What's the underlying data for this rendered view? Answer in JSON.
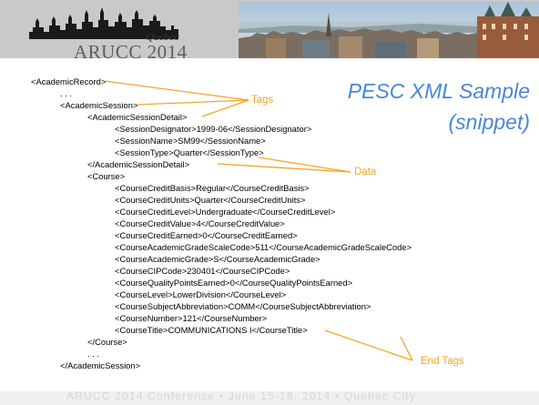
{
  "header": {
    "logo_org": "ARUCC 2014",
    "logo_place": "Quebec"
  },
  "title": {
    "line1": "PESC XML Sample",
    "line2": "(snippet)"
  },
  "code_lines": [
    "<AcademicRecord>",
    ". . .",
    "<AcademicSession>",
    "<AcademicSessionDetail>",
    "<SessionDesignator>1999-06</SessionDesignator>",
    "<SessionName>SM99</SessionName>",
    "<SessionType>Quarter</SessionType>",
    "</AcademicSessionDetail>",
    "<Course>",
    "<CourseCreditBasis>Regular</CourseCreditBasis>",
    "<CourseCreditUnits>Quarter</CourseCreditUnits>",
    "<CourseCreditLevel>Undergraduate</CourseCreditLevel>",
    "<CourseCreditValue>4</CourseCreditValue>",
    "<CourseCreditEarned>0</CourseCreditEarned>",
    "<CourseAcademicGradeScaleCode>511</CourseAcademicGradeScaleCode>",
    "<CourseAcademicGrade>S</CourseAcademicGrade>",
    "<CourseCIPCode>230401</CourseCIPCode>",
    "<CourseQualityPointsEarned>0</CourseQualityPointsEarned>",
    "<CourseLevel>LowerDivision</CourseLevel>",
    "<CourseSubjectAbbreviation>COMM</CourseSubjectAbbreviation>",
    "<CourseNumber>121</CourseNumber>",
    "<CourseTitle>COMMUNICATIONS I</CourseTitle>",
    "</Course>",
    ". . .",
    "</AcademicSession>"
  ],
  "annotations": {
    "tags": "Tags",
    "data": "Data",
    "end_tags": "End Tags"
  },
  "footer": {
    "text": "ARUCC 2014 Conference • June 15-18, 2014 • Quebec City"
  },
  "colors": {
    "title": "#4a86d8",
    "annotation": "#f5a623",
    "header_bg": "#c9c9c9",
    "footer_text": "#d6d6d6"
  }
}
